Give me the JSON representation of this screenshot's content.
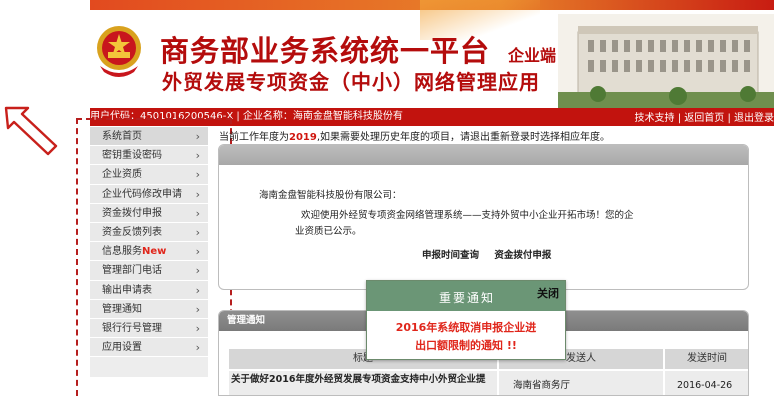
{
  "header": {
    "title_main": "商务部业务系统统一平台",
    "title_tag": "企业端",
    "title_sub": "外贸发展专项资金（中小）网络管理应用"
  },
  "infobar": {
    "left": "用户代码：450101620054​6-X | 企业名称：海南金盘智能科技股份有",
    "right": "技术支持 | 返回首页 | 退出登录"
  },
  "sidebar": {
    "items": [
      {
        "label": "系统首页",
        "chev": "›"
      },
      {
        "label": "密钥重设密码",
        "chev": "›"
      },
      {
        "label": "企业资质",
        "chev": "›"
      },
      {
        "label": "企业代码修改申请",
        "chev": "›"
      },
      {
        "label": "资金拨付申报",
        "chev": "›"
      },
      {
        "label": "资金反馈列表",
        "chev": "›"
      },
      {
        "label": "信息服务",
        "badge": "New",
        "chev": "›"
      },
      {
        "label": "管理部门电话",
        "chev": "›"
      },
      {
        "label": "输出申请表",
        "chev": "›"
      },
      {
        "label": "管理通知",
        "chev": "›"
      },
      {
        "label": "银行行号管理",
        "chev": "›"
      },
      {
        "label": "应用设置",
        "chev": "›"
      }
    ]
  },
  "notice": {
    "prefix": "当前工作年度为",
    "year": "2019",
    "suffix": ",如果需要处理历史年度的项目，请退出重新登录时选择相应年度。"
  },
  "welcome": {
    "company": "海南金盘智能科技股份有限公司：",
    "line1": "欢迎使用外经贸专项资金网络管理系统——支持外贸中小企业开拓市场！您的企",
    "line2": "业资质已公示。",
    "link1": "申报时间查询",
    "link2": "资金拨付申报"
  },
  "notices_panel": {
    "title": "管理通知",
    "columns": [
      "标题",
      "发送人",
      "发送时间"
    ],
    "rows": [
      {
        "title": "关于做好2016年度外经贸发展专项资金支持中小外贸企业提",
        "sender": "海南省商务厅",
        "time": "2016-04-26"
      }
    ]
  },
  "popup": {
    "title": "重要通知",
    "close": "关闭",
    "line1": "2016年系统取消申报企业进",
    "line2": "出口额限制的通知 !!"
  },
  "colors": {
    "brand_red": "#b40c0c",
    "infobar": "#c2130e",
    "popup_header": "#6b9676",
    "alert": "#e0261b"
  }
}
